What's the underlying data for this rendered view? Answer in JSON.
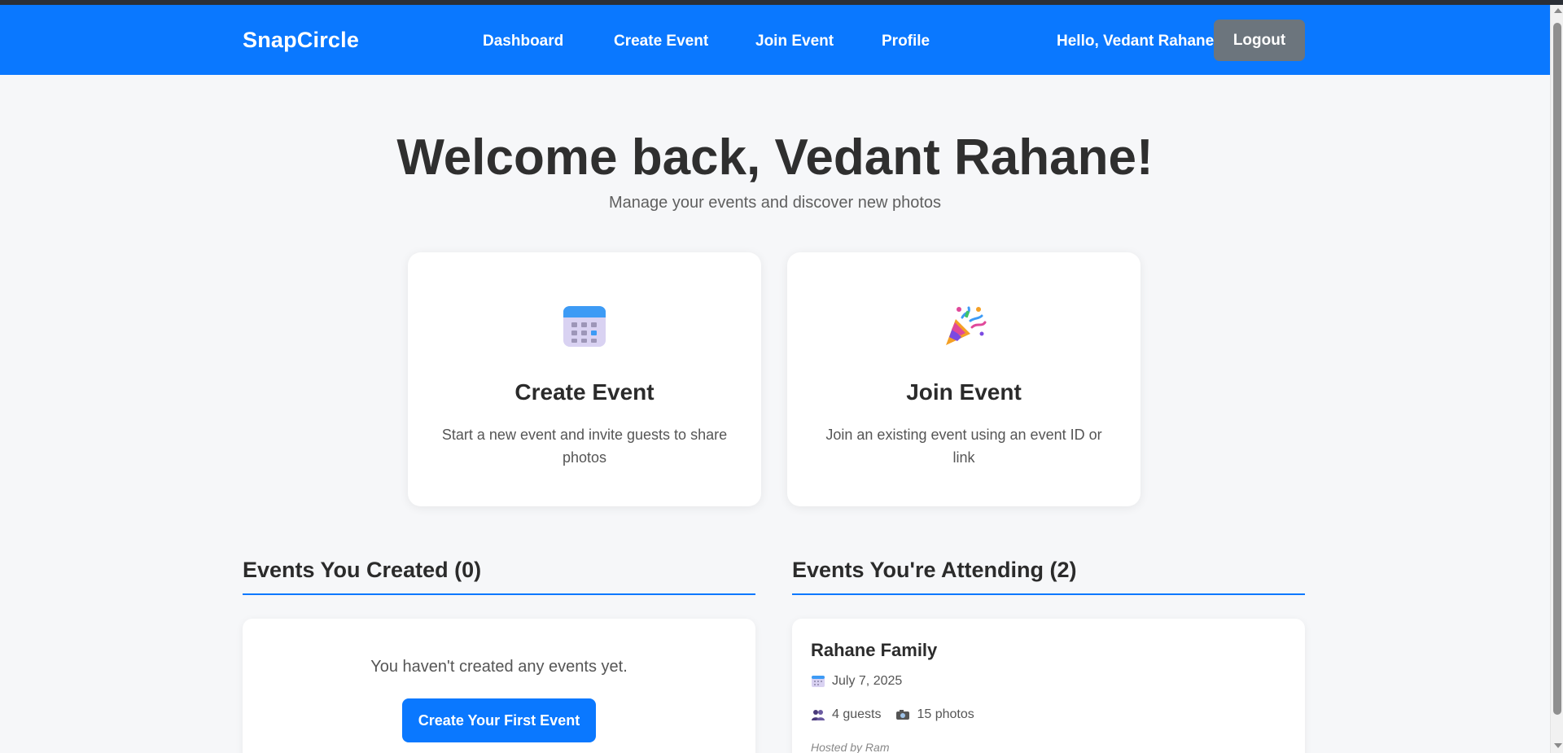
{
  "nav": {
    "brand": "SnapCircle",
    "links": [
      "Dashboard",
      "Create Event",
      "Join Event",
      "Profile"
    ],
    "greeting": "Hello, Vedant Rahane",
    "logout_label": "Logout",
    "accent_color": "#0a78ff"
  },
  "hero": {
    "title": "Welcome back, Vedant Rahane!",
    "subtitle": "Manage your events and discover new photos"
  },
  "actions": [
    {
      "icon": "calendar-icon",
      "title": "Create Event",
      "description": "Start a new event and invite guests to share photos"
    },
    {
      "icon": "party-popper-icon",
      "title": "Join Event",
      "description": "Join an existing event using an event ID or link"
    }
  ],
  "created": {
    "heading": "Events You Created (0)",
    "empty_text": "You haven't created any events yet.",
    "button_label": "Create Your First Event"
  },
  "attending": {
    "heading": "Events You're Attending (2)",
    "events": [
      {
        "name": "Rahane Family",
        "date": "July 7, 2025",
        "guests": "4 guests",
        "photos": "15 photos",
        "hosted_by": "Hosted by Ram"
      }
    ]
  }
}
